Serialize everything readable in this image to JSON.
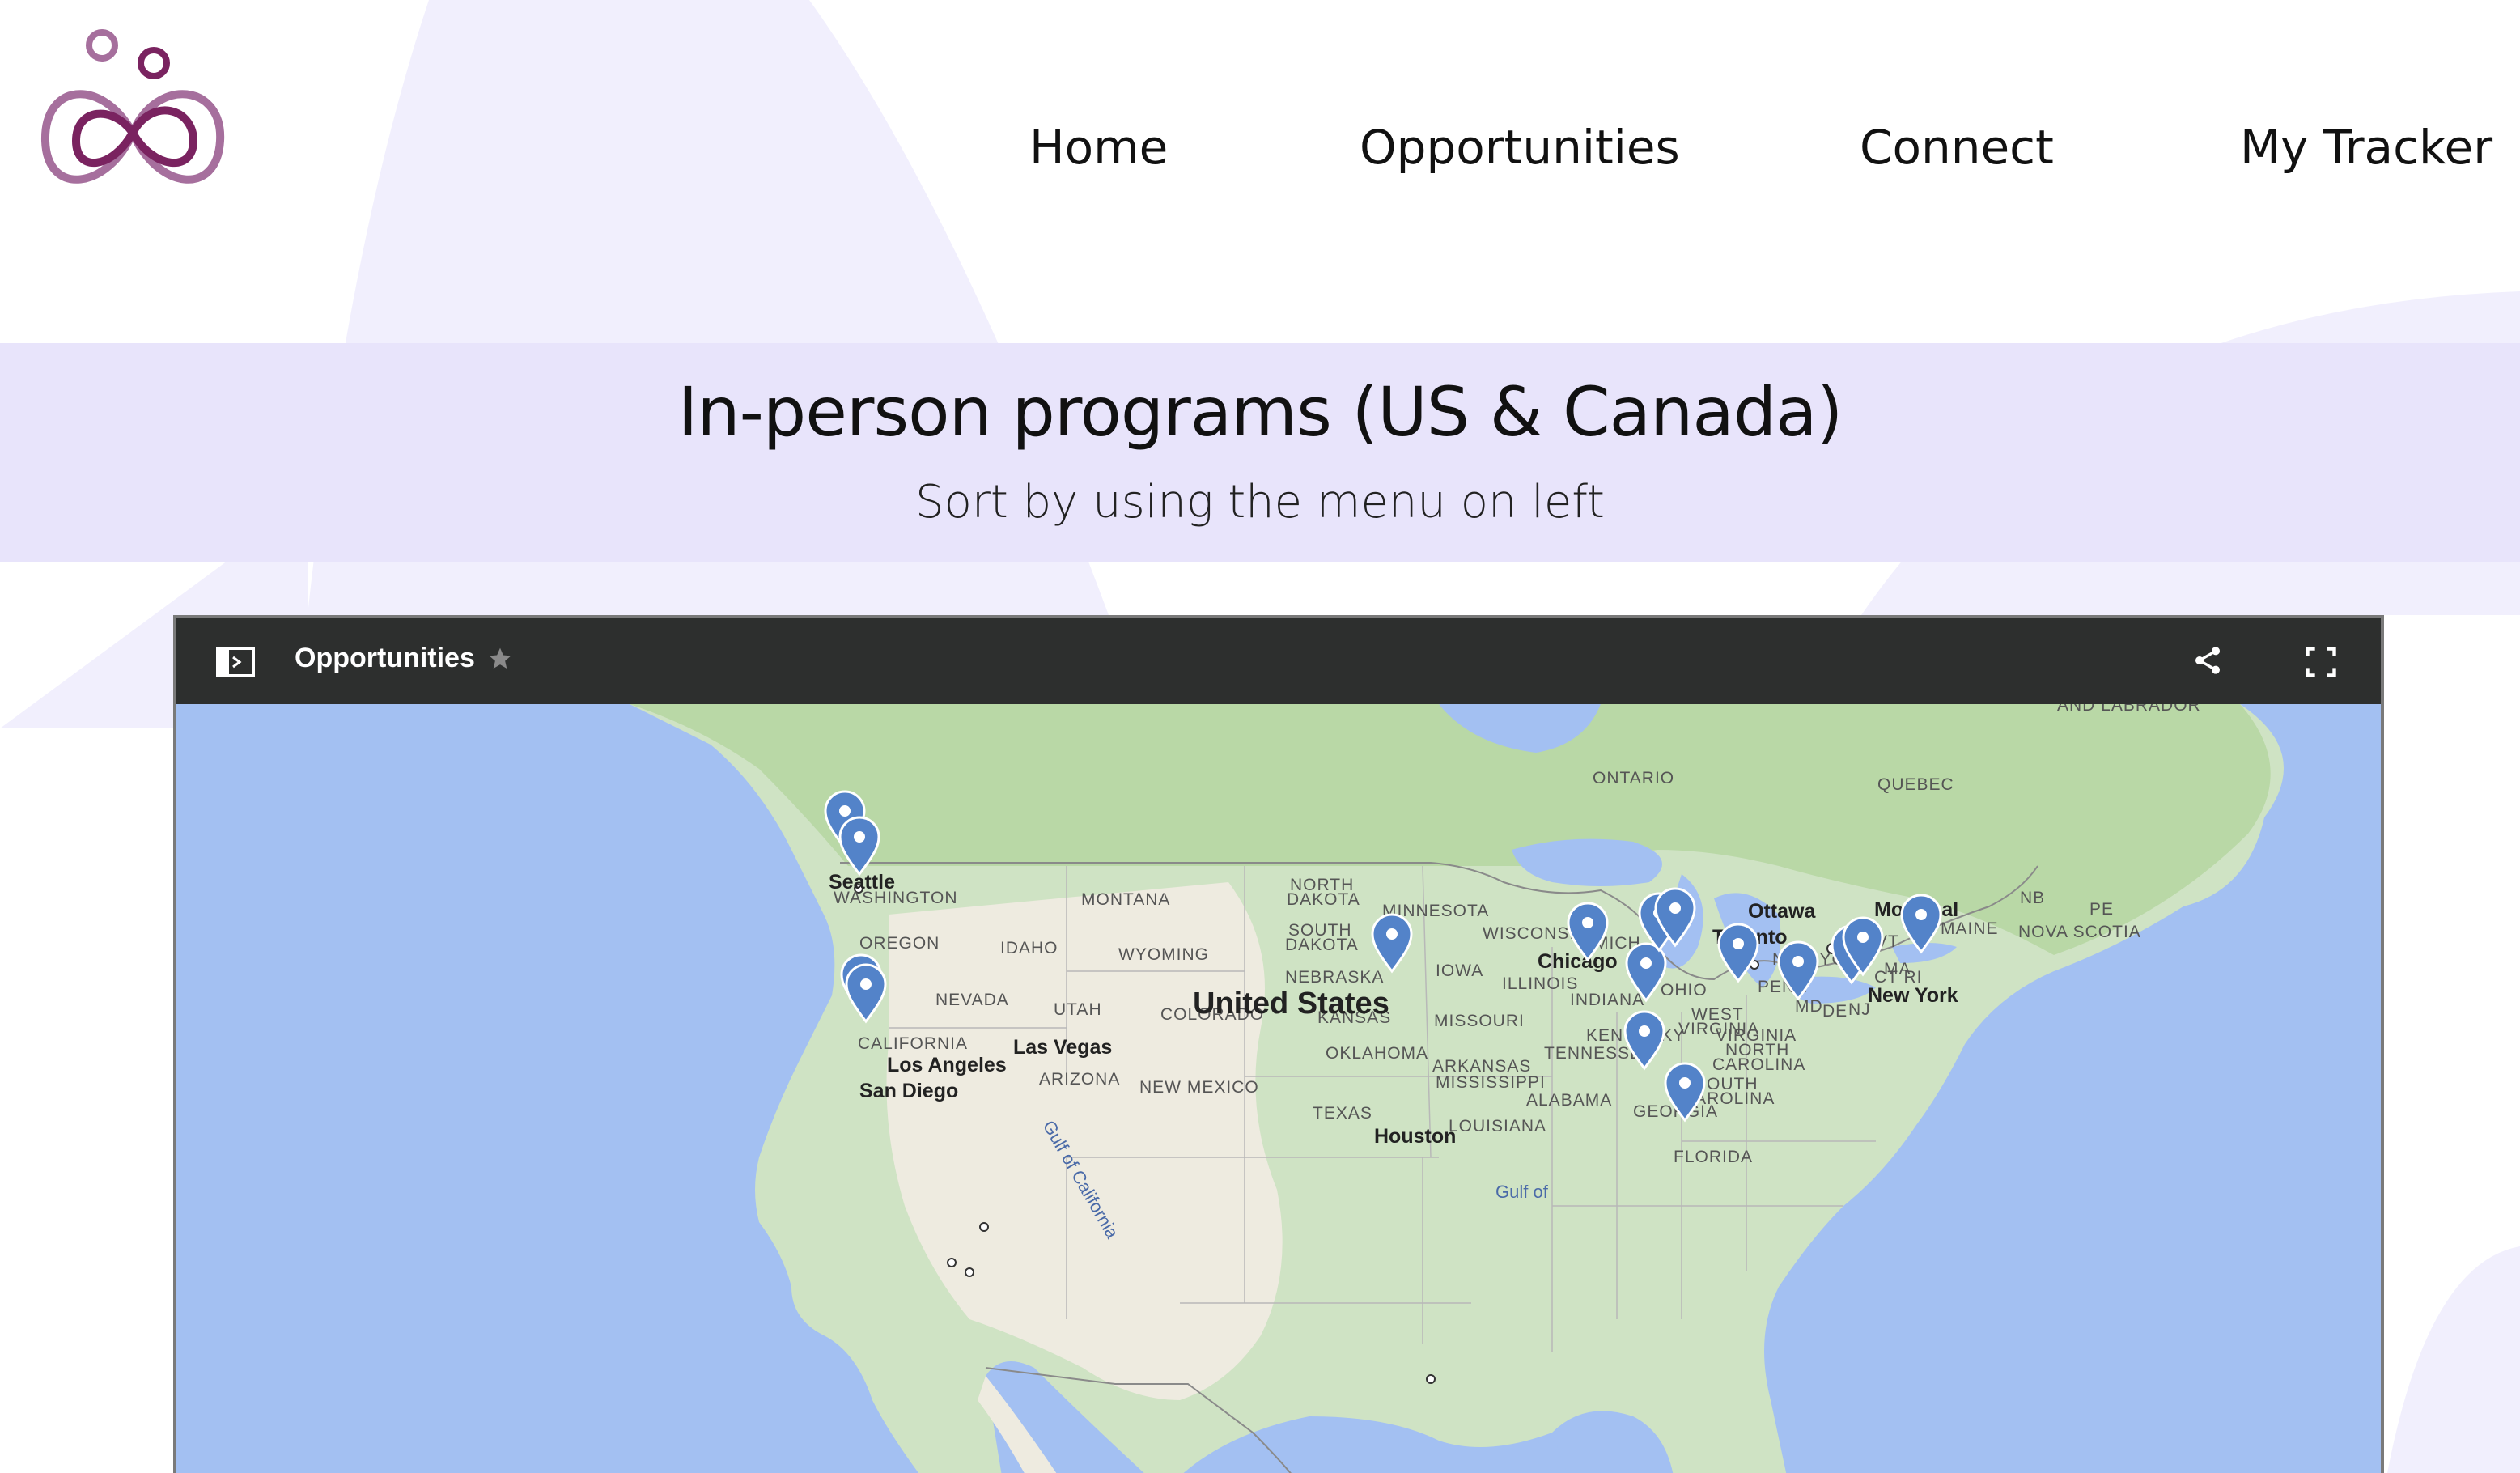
{
  "nav": {
    "logo_icon": "butterfly-infinity-logo",
    "items": [
      {
        "label": "Home"
      },
      {
        "label": "Opportunities"
      },
      {
        "label": "Connect"
      },
      {
        "label": "My Tracker"
      }
    ]
  },
  "banner": {
    "title": "In-person programs (US & Canada)",
    "subtitle": "Sort by using the menu on left"
  },
  "map": {
    "title": "Opportunities",
    "icons": [
      "sidebar-toggle-icon",
      "star-icon",
      "share-icon",
      "fullscreen-icon"
    ],
    "labels": {
      "labrador": "AND LABRADOR",
      "ontario": "ONTARIO",
      "quebec": "QUEBEC",
      "seattle": "Seattle",
      "washington": "WASHINGTON",
      "montana": "MONTANA",
      "north_dakota_1": "NORTH",
      "north_dakota_2": "DAKOTA",
      "minnesota": "MINNESOTA",
      "ottawa": "Ottawa",
      "montreal": "Montreal",
      "nb": "NB",
      "pe": "PE",
      "maine": "MAINE",
      "nova_scotia": "NOVA SCOTIA",
      "oregon": "OREGON",
      "idaho": "IDAHO",
      "south_dakota_1": "SOUTH",
      "south_dakota_2": "DAKOTA",
      "wisconsin": "WISCONSIN",
      "toronto": "Toronto",
      "vt": "VT",
      "wyoming": "WYOMING",
      "michigan": "MICH",
      "new_york_state": "NEW YORK",
      "ma": "MA",
      "chicago": "Chicago",
      "nebraska": "NEBRASKA",
      "iowa": "IOWA",
      "ct_ri": "CT RI",
      "nevada": "NEVADA",
      "united_states": "United States",
      "illinois": "ILLINOIS",
      "ohio": "OHIO",
      "penn": "PENN",
      "new_york_city": "New York",
      "utah": "UTAH",
      "colorado": "COLORADO",
      "kansas": "KANSAS",
      "indiana": "INDIANA",
      "md": "MD",
      "de": "DE",
      "nj": "NJ",
      "missouri": "MISSOURI",
      "west_virginia_1": "WEST",
      "west_virginia_2": "VIRGINIA",
      "california": "CALIFORNIA",
      "kentucky": "KENTUCKY",
      "virginia": "VIRGINIA",
      "las_vegas": "Las Vegas",
      "oklahoma": "OKLAHOMA",
      "tennessee": "TENNESSEE",
      "north_carolina_1": "NORTH",
      "north_carolina_2": "CAROLINA",
      "los_angeles": "Los Angeles",
      "arizona": "ARIZONA",
      "arkansas": "ARKANSAS",
      "new_mexico": "NEW MEXICO",
      "mississippi": "MISSISSIPPI",
      "south_carolina_1": "SOUTH",
      "south_carolina_2": "CAROLINA",
      "san_diego": "San Diego",
      "alabama": "ALABAMA",
      "georgia": "GEORGIA",
      "texas": "TEXAS",
      "louisiana": "LOUISIANA",
      "houston": "Houston",
      "florida": "FLORIDA",
      "gulf_of_california": "Gulf of California",
      "gulf_of_mexico": "Gulf of"
    }
  },
  "colors": {
    "water": "#a3c0f2",
    "land": "#cfe3c4",
    "forest": "#b9d8a6",
    "desert": "#eeebe0",
    "pin": "#5383c9",
    "banner": "#e8e4fb",
    "toolbar": "#2d2f2e",
    "logo_light": "#a66f9d",
    "logo_dark": "#7a2360"
  }
}
